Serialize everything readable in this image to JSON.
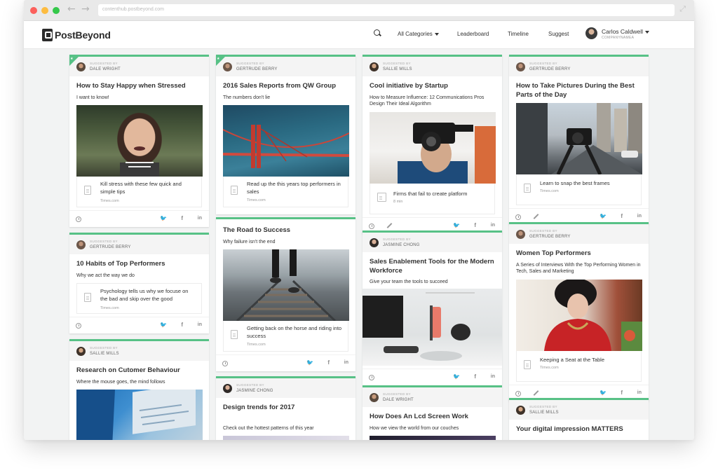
{
  "browser": {
    "url": "contenthub.postbeyond.com"
  },
  "header": {
    "logo_text": "PostBeyond",
    "nav": {
      "categories": "All Categories",
      "leaderboard": "Leaderboard",
      "timeline": "Timeline",
      "suggest": "Suggest"
    },
    "user": {
      "name": "Carlos Caldwell",
      "company": "COMPANYNAMEA"
    }
  },
  "suggested_by_label": "SUGGESTED BY",
  "colors": {
    "accent": "#57c186",
    "background": "#f2f3f3"
  },
  "cards": [
    {
      "author": "DALE WRIGHT",
      "title": "How to Stay Happy when Stressed",
      "note": "I want to know!",
      "link_text": "Kill stress with these few quick and simple tips",
      "source": "Times.com",
      "featured": true
    },
    {
      "author": "GERTRUDE BERRY",
      "title": "10 Habits of Top Performers",
      "note": "Why we act the way we do",
      "link_text": "Psychology tells us why we focuse on the bad and skip over the good",
      "source": "Times.com"
    },
    {
      "author": "SALLIE MILLS",
      "title": "Research on Cutomer Behaviour",
      "note": "Where the mouse goes, the mind follows"
    },
    {
      "author": "GERTRUDE BERRY",
      "title": "2016 Sales Reports from QW Group",
      "note": "The numbers don't lie",
      "link_text": "Read up the this years top performers in sales",
      "source": "Times.com",
      "featured": true
    },
    {
      "title": "The Road to Success",
      "note": "Why failure isn't the end",
      "link_text": "Getting back on the horse and riding into success",
      "source": "Times.com"
    },
    {
      "author": "JASMINE CHONG",
      "title": "Design trends for 2017",
      "note": "Check out  the hottest patterns of this year"
    },
    {
      "author": "SALLIE MILLS",
      "title": "Cool initiative by Startup",
      "note": "How to Measure Influence: 12 Communications Pros Design Their Ideal Algorithm",
      "link_text": "Firms that fail to create platform",
      "source": "8 min"
    },
    {
      "author": "JASMINE CHONG",
      "title": "Sales Enablement Tools for the Modern Workforce",
      "note": "Give your team the tools to succeed"
    },
    {
      "author": "DALE WRIGHT",
      "title": "How Does An Lcd Screen Work",
      "note": "How we view the world from our couches"
    },
    {
      "author": "GERTRUDE BERRY",
      "title": "How to Take Pictures During the Best Parts of the Day",
      "link_text": "Learn to snap the best frames",
      "source": "Times.com"
    },
    {
      "author": "GERTRUDE BERRY",
      "title": "Women Top Performers",
      "note": "A Series of Interviews With the Top Performing Women in Tech, Sales and Marketing",
      "link_text": "Keeping a Seat at the Table",
      "source": "Times.com"
    },
    {
      "author": "SALLIE MILLS",
      "title": "Your digital impression MATTERS"
    }
  ]
}
